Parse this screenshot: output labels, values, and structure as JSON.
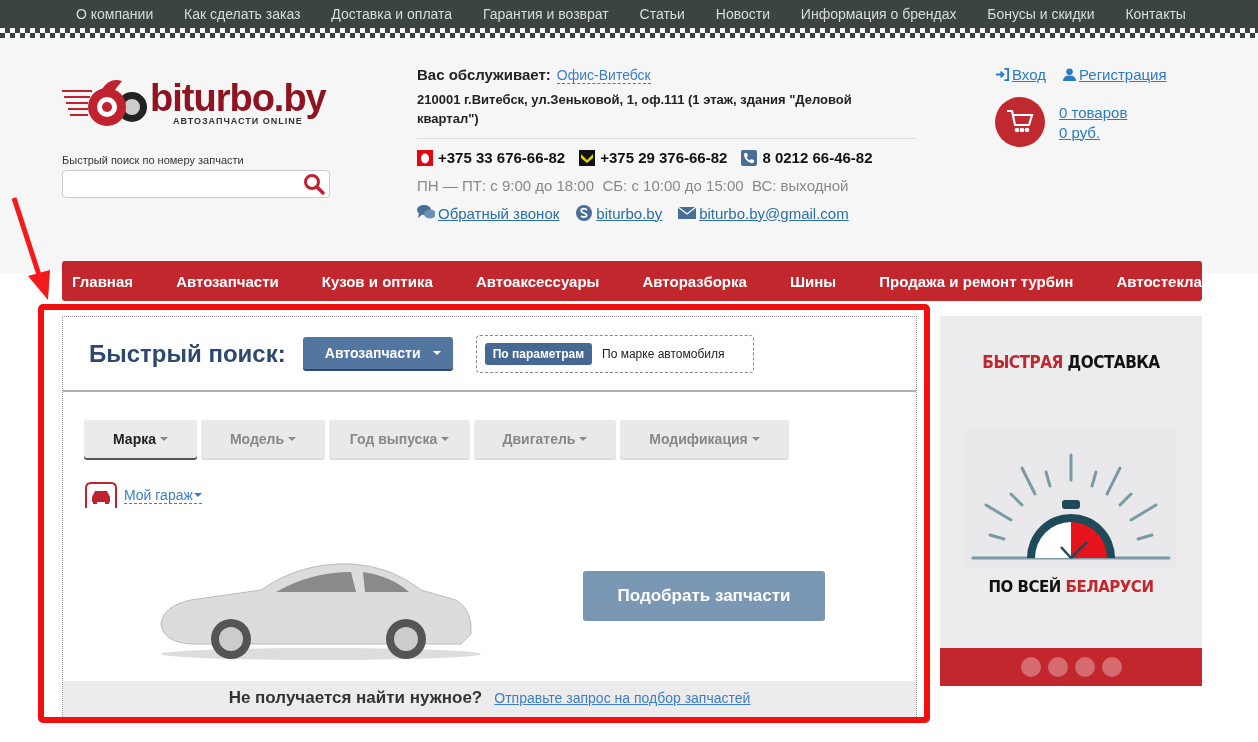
{
  "top_menu": [
    {
      "label": "О компании"
    },
    {
      "label": "Как сделать заказ"
    },
    {
      "label": "Доставка и оплата"
    },
    {
      "label": "Гарантия и возврат"
    },
    {
      "label": "Статьи"
    },
    {
      "label": "Новости"
    },
    {
      "label": "Информация о брендах"
    },
    {
      "label": "Бонусы и скидки"
    },
    {
      "label": "Контакты"
    }
  ],
  "logo": {
    "name": "biturbo.by",
    "tagline": "АВТОЗАПЧАСТИ ONLINE"
  },
  "part_search": {
    "label": "Быстрый поиск по номеру запчасти"
  },
  "office": {
    "label": "Вас обслуживает:",
    "link": "Офис-Витебск",
    "address": "210001 г.Витебск, ул.Зеньковой, 1, оф.111 (1 этаж, здания \"Деловой квартал\")"
  },
  "phones": [
    {
      "kind": "mts",
      "number": "+375 33 676-66-82"
    },
    {
      "kind": "velcom",
      "number": "+375 29 376-66-82"
    },
    {
      "kind": "landline",
      "number": "8 0212 66-46-82"
    }
  ],
  "hours": "ПН — ПТ: с 9:00 до 18:00  СБ: с 10:00 до 15:00  ВС: выходной",
  "contacts": [
    {
      "kind": "callback",
      "label": "Обратный звонок"
    },
    {
      "kind": "skype",
      "label": "biturbo.by"
    },
    {
      "kind": "email",
      "label": "biturbo.by@gmail.com"
    }
  ],
  "account": [
    {
      "kind": "login",
      "label": "Вход"
    },
    {
      "kind": "register",
      "label": "Регистрация"
    }
  ],
  "cart": {
    "items": "0 товаров",
    "total": "0 руб."
  },
  "main_nav": [
    {
      "label": "Главная"
    },
    {
      "label": "Автозапчасти"
    },
    {
      "label": "Кузов и оптика"
    },
    {
      "label": "Автоаксессуары"
    },
    {
      "label": "Авторазборка"
    },
    {
      "label": "Шины"
    },
    {
      "label": "Продажа и ремонт турбин"
    },
    {
      "label": "Автостекла"
    }
  ],
  "quick_search": {
    "title": "Быстрый поиск:",
    "category": "Автозапчасти",
    "modes": [
      {
        "label": "По параметрам",
        "selected": true
      },
      {
        "label": "По марке автомобиля",
        "selected": false
      }
    ],
    "steps": [
      {
        "label": "Марка",
        "selected": true
      },
      {
        "label": "Модель",
        "selected": false
      },
      {
        "label": "Год выпуска",
        "selected": false
      },
      {
        "label": "Двигатель",
        "selected": false
      },
      {
        "label": "Модификация",
        "selected": false
      }
    ],
    "garage": "Мой гараж",
    "submit": "Подобрать запчасти",
    "help_text": "Не получается найти нужное?",
    "help_link": "Отправьте запрос на подбор запчастей"
  },
  "banner": {
    "title_accent": "БЫСТРАЯ",
    "title_rest": "ДОСТАВКА",
    "subtitle_rest": "ПО ВСЕЙ",
    "subtitle_accent": "БЕЛАРУСИ"
  }
}
